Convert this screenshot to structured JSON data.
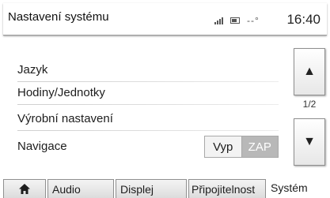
{
  "header": {
    "title": "Nastavení systému",
    "temperature": "--°",
    "time": "16:40"
  },
  "menu": {
    "items": [
      {
        "label": "Jazyk"
      },
      {
        "label": "Hodiny/Jednotky"
      },
      {
        "label": "Výrobní nastavení"
      },
      {
        "label": "Navigace"
      }
    ],
    "navigation_toggle": {
      "off_label": "Vyp",
      "on_label": "ZAP",
      "selected": "ZAP"
    }
  },
  "scroll": {
    "page_indicator": "1/2",
    "up_icon": "arrow-up-icon",
    "down_icon": "arrow-down-icon"
  },
  "tabs": [
    {
      "icon": "home-icon"
    },
    {
      "label": "Audio"
    },
    {
      "label": "Displej"
    },
    {
      "label": "Připojitelnost"
    },
    {
      "label": "Systém",
      "active": true
    }
  ],
  "colors": {
    "background": "#ffffff",
    "toggle_active": "#b8b8b8",
    "separator": "#cfcfcf"
  }
}
